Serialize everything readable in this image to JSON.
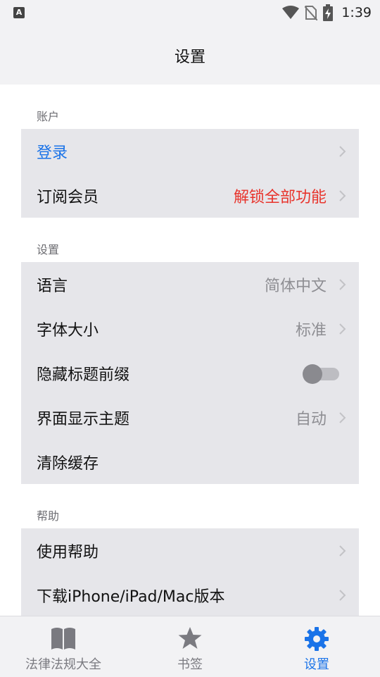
{
  "status_bar": {
    "app_icon": "A",
    "time": "1:39",
    "icons": [
      "wifi-icon",
      "no-sim-icon",
      "battery-charging-icon"
    ]
  },
  "nav": {
    "title": "设置"
  },
  "sections": {
    "account": {
      "header": "账户",
      "login_label": "登录",
      "subscribe_label": "订阅会员",
      "subscribe_value": "解锁全部功能"
    },
    "settings": {
      "header": "设置",
      "language_label": "语言",
      "language_value": "简体中文",
      "font_size_label": "字体大小",
      "font_size_value": "标准",
      "hide_prefix_label": "隐藏标题前缀",
      "hide_prefix_on": false,
      "theme_label": "界面显示主题",
      "theme_value": "自动",
      "clear_cache_label": "清除缓存"
    },
    "help": {
      "header": "帮助",
      "help_label": "使用帮助",
      "download_label": "下载iPhone/iPad/Mac版本"
    }
  },
  "tab_bar": {
    "tabs": [
      {
        "label": "法律法规大全",
        "icon": "book-icon",
        "active": false
      },
      {
        "label": "书签",
        "icon": "star-icon",
        "active": false
      },
      {
        "label": "设置",
        "icon": "gear-icon",
        "active": true
      }
    ]
  },
  "colors": {
    "accent": "#1a73e8",
    "warning": "#e8342c",
    "group_bg": "#e6e6ea",
    "bar_bg": "#f2f2f4"
  }
}
